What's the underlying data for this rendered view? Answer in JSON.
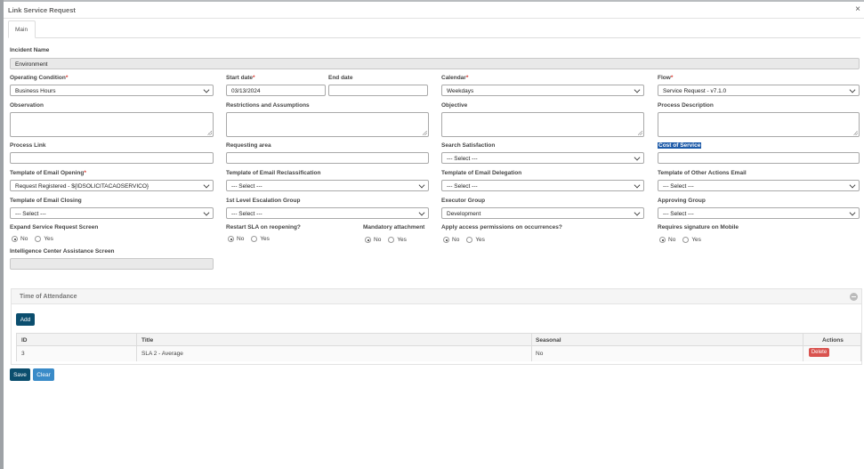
{
  "dialog": {
    "title": "Link Service Request",
    "close_symbol": "×"
  },
  "tabs": [
    "Main"
  ],
  "form": {
    "incident_name": {
      "label": "Incident Name",
      "value": "Environment"
    },
    "operating_condition": {
      "label": "Operating Condition",
      "value": "Business Hours",
      "required": true
    },
    "start_date": {
      "label": "Start date",
      "value": "03/13/2024",
      "required": true
    },
    "end_date": {
      "label": "End date",
      "value": ""
    },
    "calendar": {
      "label": "Calendar",
      "value": "Weekdays",
      "required": true
    },
    "flow": {
      "label": "Flow",
      "value": "Service Request - v7.1.0",
      "required": true
    },
    "observation": {
      "label": "Observation"
    },
    "restrictions": {
      "label": "Restrictions and Assumptions"
    },
    "objective": {
      "label": "Objective"
    },
    "process_description": {
      "label": "Process Description"
    },
    "process_link": {
      "label": "Process Link"
    },
    "requesting_area": {
      "label": "Requesting area"
    },
    "search_satisfaction": {
      "label": "Search Satisfaction",
      "value": "--- Select ---"
    },
    "cost_of_service": {
      "label": "Cost of Service"
    },
    "tpl_email_opening": {
      "label": "Template of Email Opening",
      "value": "Request Registered - ${IDSOLICITACAOSERVICO}",
      "required": true
    },
    "tpl_email_reclassification": {
      "label": "Template of Email Reclassification",
      "value": "--- Select ---"
    },
    "tpl_email_delegation": {
      "label": "Template of Email Delegation",
      "value": "--- Select ---"
    },
    "tpl_other_actions_email": {
      "label": "Template of Other Actions Email",
      "value": "--- Select ---"
    },
    "tpl_email_closing": {
      "label": "Template of Email Closing",
      "value": "--- Select ---"
    },
    "first_level_escalation": {
      "label": "1st Level Escalation Group",
      "value": "--- Select ---"
    },
    "executor_group": {
      "label": "Executor Group",
      "value": "Development"
    },
    "approving_group": {
      "label": "Approving Group",
      "value": "--- Select ---"
    },
    "expand_screen": {
      "label": "Expand Service Request Screen",
      "selected": "No"
    },
    "restart_sla": {
      "label": "Restart SLA on reopening?",
      "selected": "No"
    },
    "mandatory_attachment": {
      "label": "Mandatory attachment",
      "selected": "No"
    },
    "apply_permissions": {
      "label": "Apply access permissions on occurrences?",
      "selected": "No"
    },
    "requires_signature": {
      "label": "Requires signature on Mobile",
      "selected": "No"
    },
    "intelligence_center": {
      "label": "Intelligence Center Assistance Screen",
      "value": ""
    },
    "radio_options": {
      "no": "No",
      "yes": "Yes"
    }
  },
  "time_of_attendance": {
    "title": "Time of Attendance",
    "add_label": "Add",
    "columns": [
      "ID",
      "Title",
      "Seasonal",
      "Actions"
    ],
    "rows": [
      {
        "id": "3",
        "title": "SLA 2 - Average",
        "seasonal": "No",
        "action": "Delete"
      }
    ]
  },
  "footer": {
    "save_label": "Save",
    "clear_label": "Clear"
  },
  "colors": {
    "required": "#d9342b",
    "primary": "#0b4e6e",
    "secondary": "#3a8bc8",
    "danger": "#d9534f",
    "highlight": "#1c5aa8"
  }
}
